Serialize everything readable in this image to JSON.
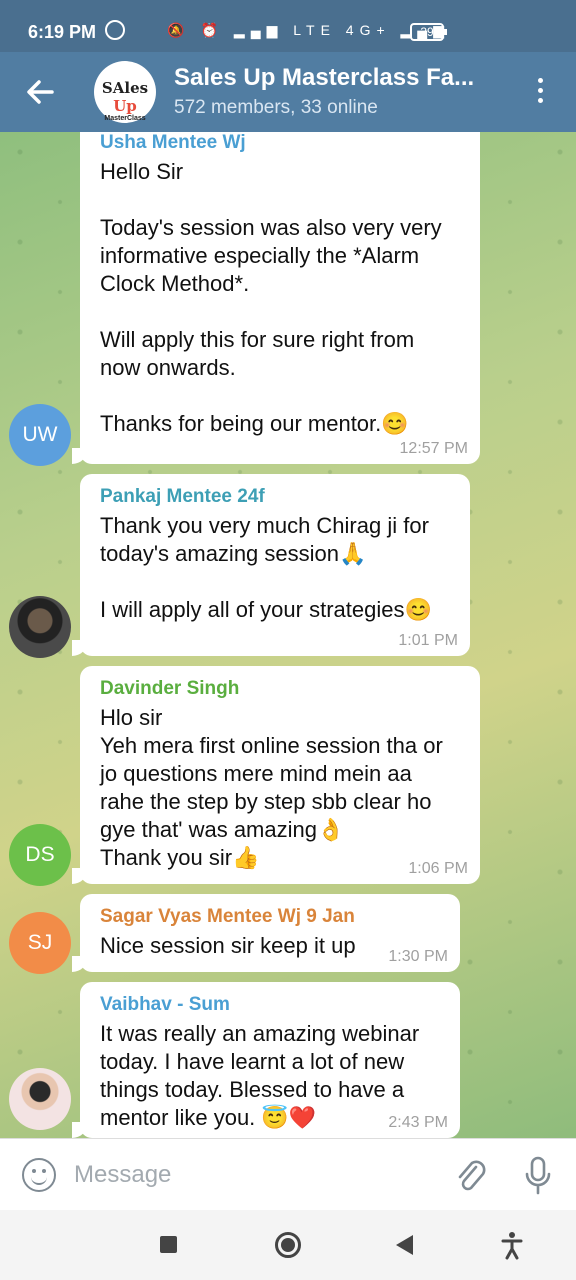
{
  "status_bar": {
    "time": "6:19 PM",
    "icons": "🔕 ⏰ ▂▄▆ LTE 4G+ ▂▄▆",
    "battery": "39"
  },
  "header": {
    "back_icon": "arrow-left-icon",
    "group_avatar": {
      "line1_a": "SAles",
      "line1_b": "Up",
      "line2": "MasterClass"
    },
    "title": "Sales Up Masterclass Fa...",
    "subtitle": "572 members, 33 online",
    "menu_icon": "more-vertical-icon"
  },
  "messages": [
    {
      "sender": "Usha Mentee Wj",
      "sender_color": "#4a9fd3",
      "avatar_text": "UW",
      "avatar_color": "#5c9fdd",
      "text": "Hello Sir\n\nToday's session was also very very informative especially the *Alarm Clock Method*.\n\nWill apply this for sure right from now onwards.\n\nThanks for being our mentor.😊",
      "time": "12:57 PM"
    },
    {
      "sender": "Pankaj Mentee 24f",
      "sender_color": "#3d9fb5",
      "avatar_text": "",
      "text": "Thank you very much Chirag ji for today's amazing session🙏\n\nI will apply all of your strategies😊",
      "time": "1:01 PM"
    },
    {
      "sender": "Davinder Singh",
      "sender_color": "#5aae3f",
      "avatar_text": "DS",
      "avatar_color": "#6cc04a",
      "text": "Hlo sir\nYeh mera first online session tha or jo questions mere mind mein aa rahe the step by step sbb clear ho gye that' was amazing👌\nThank you sir👍",
      "time": "1:06 PM"
    },
    {
      "sender": "Sagar Vyas Mentee Wj 9 Jan",
      "sender_color": "#d9843a",
      "avatar_text": "SJ",
      "avatar_color": "#f28c48",
      "text": "Nice session sir keep it up",
      "time": "1:30 PM"
    },
    {
      "sender": "Vaibhav - Sum",
      "sender_color": "#4a9fd3",
      "avatar_text": "",
      "text": "It was really an amazing webinar today. I have learnt a lot of new things today. Blessed to have a mentor like you. 😇❤️",
      "time": "2:43 PM"
    }
  ],
  "input": {
    "placeholder": "Message",
    "emoji_icon": "emoji-icon",
    "attach_icon": "paperclip-icon",
    "mic_icon": "microphone-icon"
  },
  "navbar": {
    "recent_icon": "square-icon",
    "home_icon": "circle-icon",
    "back_icon": "triangle-back-icon",
    "accessibility_icon": "accessibility-icon"
  }
}
